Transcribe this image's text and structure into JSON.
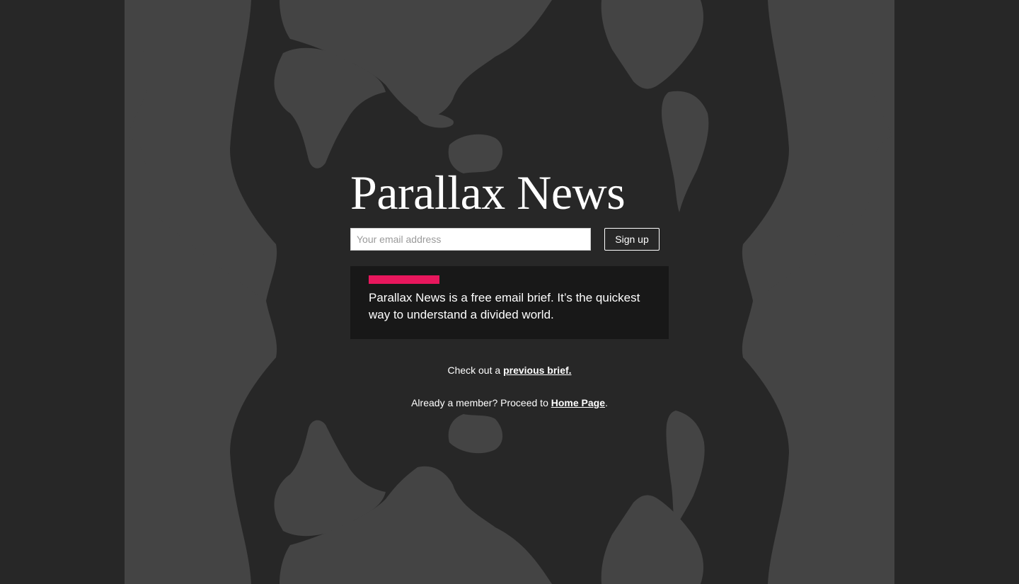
{
  "site": {
    "title": "Parallax News"
  },
  "signup": {
    "email_placeholder": "Your email address",
    "button_label": "Sign up"
  },
  "brief": {
    "accent_color": "#e8175d",
    "text": "Parallax News is a free email brief. It’s the quickest way to understand a divided world."
  },
  "previous_brief": {
    "prefix": "Check out a ",
    "link_label": "previous brief."
  },
  "member": {
    "prefix": "Already a member? Proceed to ",
    "link_label": "Home Page",
    "suffix": "."
  },
  "colors": {
    "background": "#272727",
    "silhouette": "#444444",
    "panel": "#181818",
    "accent": "#e8175d"
  },
  "icons": {
    "background_art": "head-silhouettes-world-map-art"
  }
}
